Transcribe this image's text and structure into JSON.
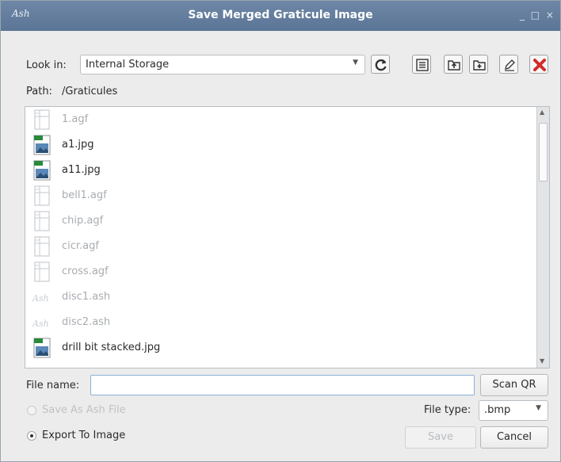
{
  "window": {
    "app_icon_text": "Ash",
    "title": "Save Merged Graticule Image",
    "controls": "_ □ ×"
  },
  "look_in": {
    "label": "Look in:",
    "value": "Internal Storage"
  },
  "path": {
    "label": "Path:",
    "value": "/Graticules"
  },
  "toolbar": {
    "icons": [
      "refresh-icon",
      "list-view-icon",
      "parent-folder-icon",
      "new-folder-icon",
      "rename-icon",
      "delete-icon"
    ],
    "delete_color": "#d22b2b"
  },
  "files": [
    {
      "name": "1.agf",
      "type": "agf",
      "enabled": false
    },
    {
      "name": "a1.jpg",
      "type": "jpg",
      "enabled": true
    },
    {
      "name": "a11.jpg",
      "type": "jpg",
      "enabled": true
    },
    {
      "name": "bell1.agf",
      "type": "agf",
      "enabled": false
    },
    {
      "name": "chip.agf",
      "type": "agf",
      "enabled": false
    },
    {
      "name": "cicr.agf",
      "type": "agf",
      "enabled": false
    },
    {
      "name": "cross.agf",
      "type": "agf",
      "enabled": false
    },
    {
      "name": "disc1.ash",
      "type": "ash",
      "enabled": false
    },
    {
      "name": "disc2.ash",
      "type": "ash",
      "enabled": false
    },
    {
      "name": "drill bit stacked.jpg",
      "type": "jpg",
      "enabled": true
    }
  ],
  "filename": {
    "label": "File name:",
    "value": "",
    "scan_label": "Scan QR"
  },
  "options": {
    "save_ash_label": "Save As Ash File",
    "export_label": "Export To Image",
    "selected": "export"
  },
  "filetype": {
    "label": "File type:",
    "value": ".bmp"
  },
  "actions": {
    "save_label": "Save",
    "cancel_label": "Cancel"
  }
}
